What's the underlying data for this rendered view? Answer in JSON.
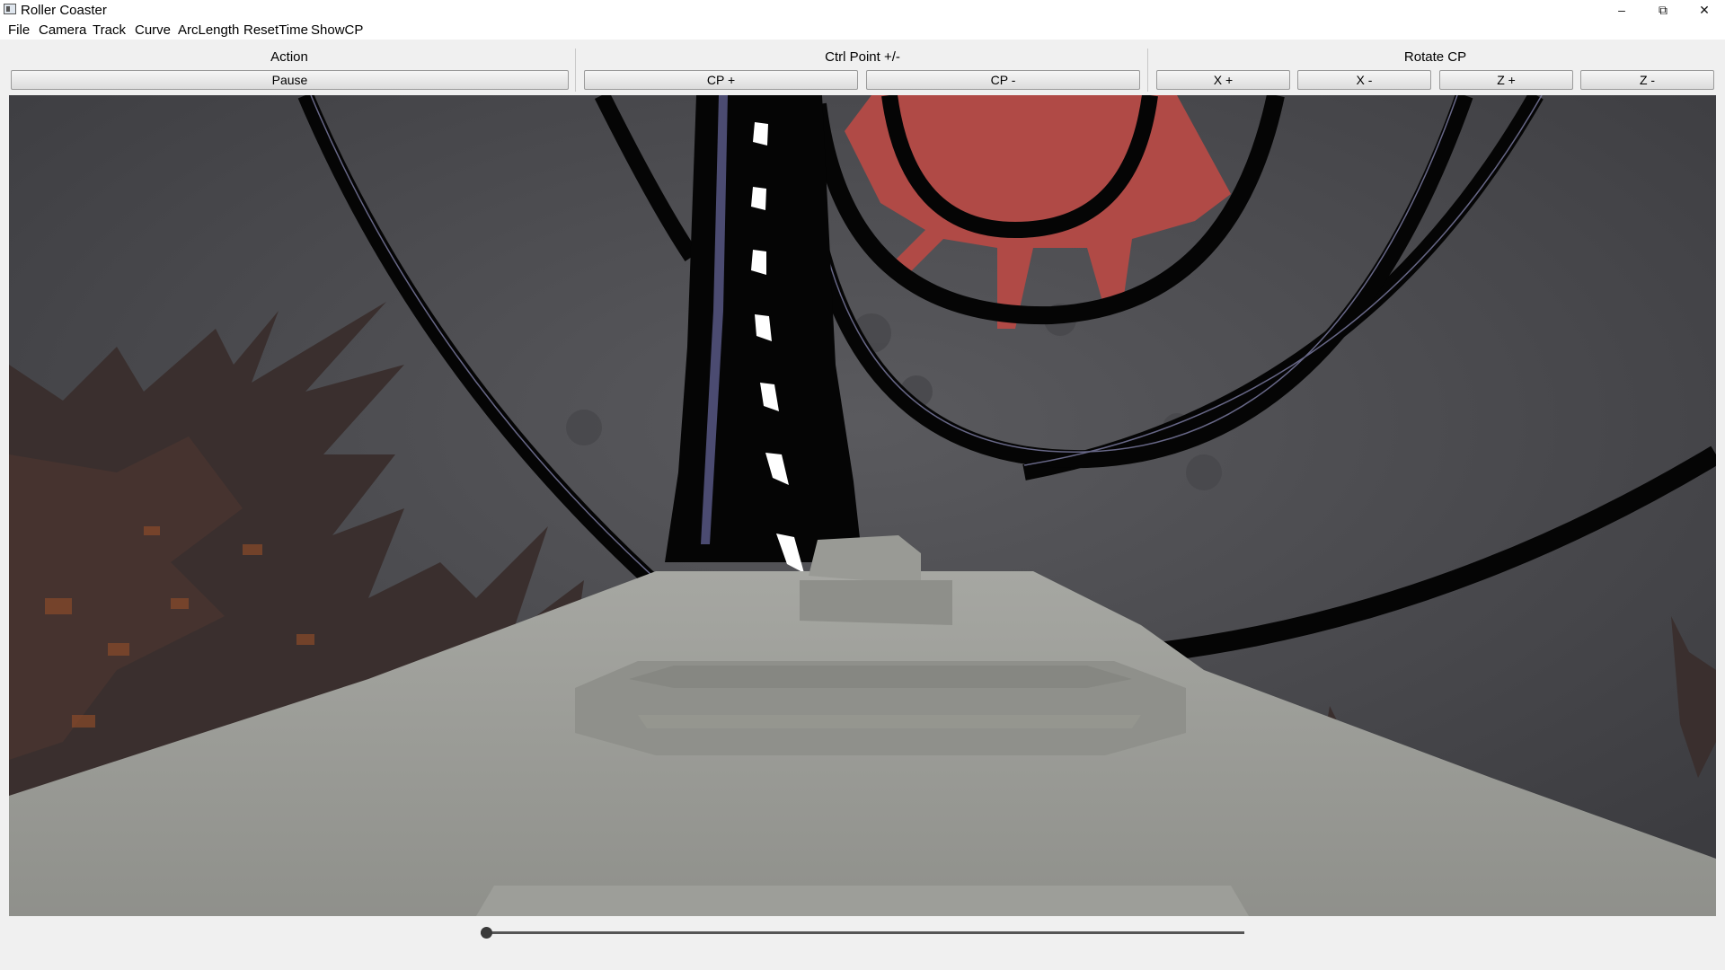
{
  "window": {
    "title": "Roller Coaster",
    "controls": {
      "minimize": "–",
      "restore": "⧉",
      "close": "✕"
    }
  },
  "menu": [
    "File",
    "Camera",
    "Track",
    "Curve",
    "ArcLength",
    "ResetTime",
    "ShowCP"
  ],
  "groups": {
    "action": {
      "title": "Action",
      "pause_label": "Pause"
    },
    "ctrl_point": {
      "title": "Ctrl Point +/-",
      "add_label": "CP +",
      "remove_label": "CP -"
    },
    "rotate_cp": {
      "title": "Rotate CP",
      "x_plus": "X +",
      "x_minus": "X -",
      "z_plus": "Z +",
      "z_minus": "Z -"
    }
  },
  "scene": {
    "sky_color": "#4e4e52",
    "track_color": "#050505",
    "rail_highlight": "#8080a8",
    "flower_color": "#b04a46",
    "spire_color": "#3a2f2e",
    "spire_accent": "#8a4a2a",
    "train_color": "#9a9b96"
  },
  "timeline": {
    "position": 0
  }
}
